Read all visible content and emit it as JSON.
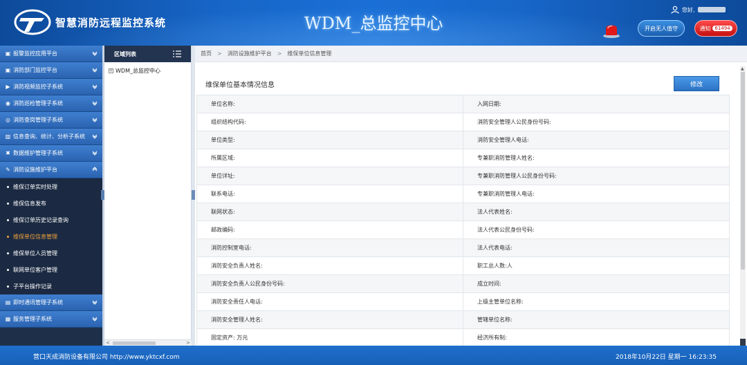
{
  "header": {
    "system_title": "智慧消防远程监控系统",
    "center_title": "WDM_总监控中心",
    "greeting": "您好,",
    "btn_unmanned": "开启无人值守",
    "btn_notice": "通知",
    "notice_count": "61494"
  },
  "menu": {
    "items": [
      {
        "label": "报警监控应用平台"
      },
      {
        "label": "消防部门监控平台"
      },
      {
        "label": "消防视频监控子系统"
      },
      {
        "label": "消防巡检管理子系统"
      },
      {
        "label": "消防查岗管理子系统"
      },
      {
        "label": "信息查询、统计、分析子系统"
      },
      {
        "label": "数据维护管理子系统"
      },
      {
        "label": "消防设施维护平台"
      }
    ],
    "sub_items": [
      {
        "label": "维保订单实时处理"
      },
      {
        "label": "维保信息发布"
      },
      {
        "label": "维保订单历史记录查询"
      },
      {
        "label": "维保单位信息管理"
      },
      {
        "label": "维保单位人员管理"
      },
      {
        "label": "联网单位客户管理"
      },
      {
        "label": "子平台操作记录"
      }
    ],
    "bottom_items": [
      {
        "label": "即时通讯管理子系统"
      },
      {
        "label": "服务管理子系统"
      }
    ]
  },
  "area": {
    "title": "区域列表",
    "root_node": "WDM_总监控中心"
  },
  "breadcrumb": {
    "home": "首页",
    "level1": "消防设施维护平台",
    "level2": "维保单位信息管理"
  },
  "main": {
    "panel_title": "维保单位基本情况信息",
    "edit_label": "修改",
    "rows": [
      {
        "left": "单位名称:",
        "right": "入网日期:"
      },
      {
        "left": "组织结构代码:",
        "right": "消防安全管理人公民身份号码:"
      },
      {
        "left": "单位类型:",
        "right": "消防安全管理人电话:"
      },
      {
        "left": "所属区域:",
        "right": "专兼职消防管理人姓名:"
      },
      {
        "left": "单位详址:",
        "right": "专兼职消防管理人公民身份号码:"
      },
      {
        "left": "联系电话:",
        "right": "专兼职消防管理人电话:"
      },
      {
        "left": "联网状态:",
        "right": "法人代表姓名:"
      },
      {
        "left": "邮政编码:",
        "right": "法人代表公民身份号码:"
      },
      {
        "left": "消防控制室电话:",
        "right": "法人代表电话:"
      },
      {
        "left": "消防安全负责人姓名:",
        "right": "职工总人数:人"
      },
      {
        "left": "消防安全负责人公民身份号码:",
        "right": "成立时间:"
      },
      {
        "left": "消防安全责任人电话:",
        "right": "上级主管单位名称:"
      },
      {
        "left": "消防安全管理人姓名:",
        "right": "管辖单位名称:"
      },
      {
        "left": "固定资产:  万元",
        "right": "经济所有制:"
      }
    ]
  },
  "footer": {
    "company": "营口天成消防设备有限公司 http://www.yktcxf.com",
    "datetime": "2018年10月22日 星期一 16:23:35"
  },
  "colors": {
    "header_blue": "#1766c8",
    "menu_blue": "#3f7fd0",
    "active_orange": "#f0a23c",
    "notice_red": "#e02020"
  }
}
